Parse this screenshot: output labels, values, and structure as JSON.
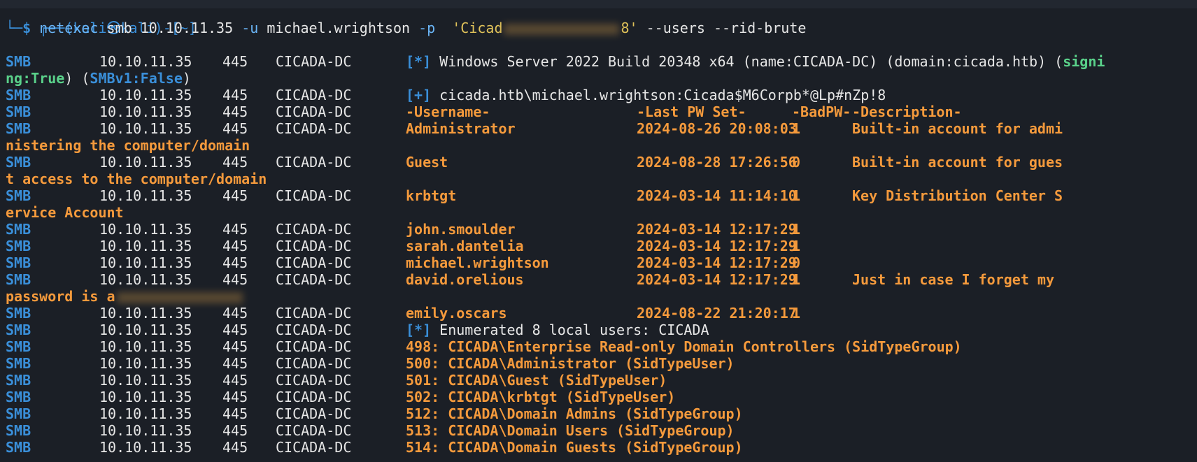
{
  "prompt": {
    "line1": "┌──(kali㉿kali)-[~]",
    "corner": "└─",
    "dollar": "$",
    "binary": "netexec",
    "args_before": " smb 10.10.11.35 ",
    "opt_u": "-u",
    "user": " michael.wrightson ",
    "opt_p": "-p",
    "pass_open": "  'Cicad",
    "pass_close": "8'",
    "flags": " --users --rid-brute"
  },
  "rows": [
    {
      "proto": "SMB",
      "ip": "10.10.11.35",
      "port": "445",
      "host": "CICADA-DC",
      "kind": "star",
      "marker": "[*]",
      "text": " Windows Server 2022 Build 20348 x64 (name:CICADA-DC) (domain:cicada.htb) (",
      "tail_green": "signi"
    },
    {
      "proto": "",
      "cont_green": "ng:True",
      "cont_white": ") (",
      "cont_blue": "SMBv1:False",
      "cont_end": ")"
    },
    {
      "proto": "SMB",
      "ip": "10.10.11.35",
      "port": "445",
      "host": "CICADA-DC",
      "kind": "plus",
      "marker": "[+]",
      "text": " cicada.htb\\michael.wrightson:Cicada$M6Corpb*@Lp#nZp!8"
    },
    {
      "proto": "SMB",
      "ip": "10.10.11.35",
      "port": "445",
      "host": "CICADA-DC",
      "kind": "hdr",
      "user": "-Username-",
      "pwset": "-Last PW Set-",
      "bad": "-BadPW-",
      "desc": "-Description-"
    },
    {
      "proto": "SMB",
      "ip": "10.10.11.35",
      "port": "445",
      "host": "CICADA-DC",
      "kind": "user",
      "user": "Administrator",
      "pwset": "2024-08-26 20:08:03",
      "bad": "1",
      "desc": "Built-in account for admi"
    },
    {
      "proto": "",
      "cont": "nistering the computer/domain"
    },
    {
      "proto": "SMB",
      "ip": "10.10.11.35",
      "port": "445",
      "host": "CICADA-DC",
      "kind": "user",
      "user": "Guest",
      "pwset": "2024-08-28 17:26:56",
      "bad": "0",
      "desc": "Built-in account for gues"
    },
    {
      "proto": "",
      "cont": "t access to the computer/domain"
    },
    {
      "proto": "SMB",
      "ip": "10.10.11.35",
      "port": "445",
      "host": "CICADA-DC",
      "kind": "user",
      "user": "krbtgt",
      "pwset": "2024-03-14 11:14:10",
      "bad": "1",
      "desc": "Key Distribution Center S"
    },
    {
      "proto": "",
      "cont": "ervice Account"
    },
    {
      "proto": "SMB",
      "ip": "10.10.11.35",
      "port": "445",
      "host": "CICADA-DC",
      "kind": "user",
      "user": "john.smoulder",
      "pwset": "2024-03-14 12:17:29",
      "bad": "1",
      "desc": ""
    },
    {
      "proto": "SMB",
      "ip": "10.10.11.35",
      "port": "445",
      "host": "CICADA-DC",
      "kind": "user",
      "user": "sarah.dantelia",
      "pwset": "2024-03-14 12:17:29",
      "bad": "1",
      "desc": ""
    },
    {
      "proto": "SMB",
      "ip": "10.10.11.35",
      "port": "445",
      "host": "CICADA-DC",
      "kind": "user",
      "user": "michael.wrightson",
      "pwset": "2024-03-14 12:17:29",
      "bad": "0",
      "desc": ""
    },
    {
      "proto": "SMB",
      "ip": "10.10.11.35",
      "port": "445",
      "host": "CICADA-DC",
      "kind": "user",
      "user": "david.orelious",
      "pwset": "2024-03-14 12:17:29",
      "bad": "1",
      "desc": "Just in case I forget my"
    },
    {
      "proto": "",
      "cont": "password is a",
      "blurred": true
    },
    {
      "proto": "SMB",
      "ip": "10.10.11.35",
      "port": "445",
      "host": "CICADA-DC",
      "kind": "user",
      "user": "emily.oscars",
      "pwset": "2024-08-22 21:20:17",
      "bad": "1",
      "desc": ""
    },
    {
      "proto": "SMB",
      "ip": "10.10.11.35",
      "port": "445",
      "host": "CICADA-DC",
      "kind": "star",
      "marker": "[*]",
      "text": " Enumerated 8 local users: CICADA"
    },
    {
      "proto": "SMB",
      "ip": "10.10.11.35",
      "port": "445",
      "host": "CICADA-DC",
      "kind": "rid",
      "text": "498: CICADA\\Enterprise Read-only Domain Controllers (SidTypeGroup)"
    },
    {
      "proto": "SMB",
      "ip": "10.10.11.35",
      "port": "445",
      "host": "CICADA-DC",
      "kind": "rid",
      "text": "500: CICADA\\Administrator (SidTypeUser)"
    },
    {
      "proto": "SMB",
      "ip": "10.10.11.35",
      "port": "445",
      "host": "CICADA-DC",
      "kind": "rid",
      "text": "501: CICADA\\Guest (SidTypeUser)"
    },
    {
      "proto": "SMB",
      "ip": "10.10.11.35",
      "port": "445",
      "host": "CICADA-DC",
      "kind": "rid",
      "text": "502: CICADA\\krbtgt (SidTypeUser)"
    },
    {
      "proto": "SMB",
      "ip": "10.10.11.35",
      "port": "445",
      "host": "CICADA-DC",
      "kind": "rid",
      "text": "512: CICADA\\Domain Admins (SidTypeGroup)"
    },
    {
      "proto": "SMB",
      "ip": "10.10.11.35",
      "port": "445",
      "host": "CICADA-DC",
      "kind": "rid",
      "text": "513: CICADA\\Domain Users (SidTypeGroup)"
    },
    {
      "proto": "SMB",
      "ip": "10.10.11.35",
      "port": "445",
      "host": "CICADA-DC",
      "kind": "rid",
      "text": "514: CICADA\\Domain Guests (SidTypeGroup)"
    }
  ],
  "colors": {
    "background": "#1b1f26",
    "smb_blue": "#3a8fd9",
    "orange": "#f59a3c",
    "green": "#5ad18a",
    "text": "#e6e6e6"
  }
}
